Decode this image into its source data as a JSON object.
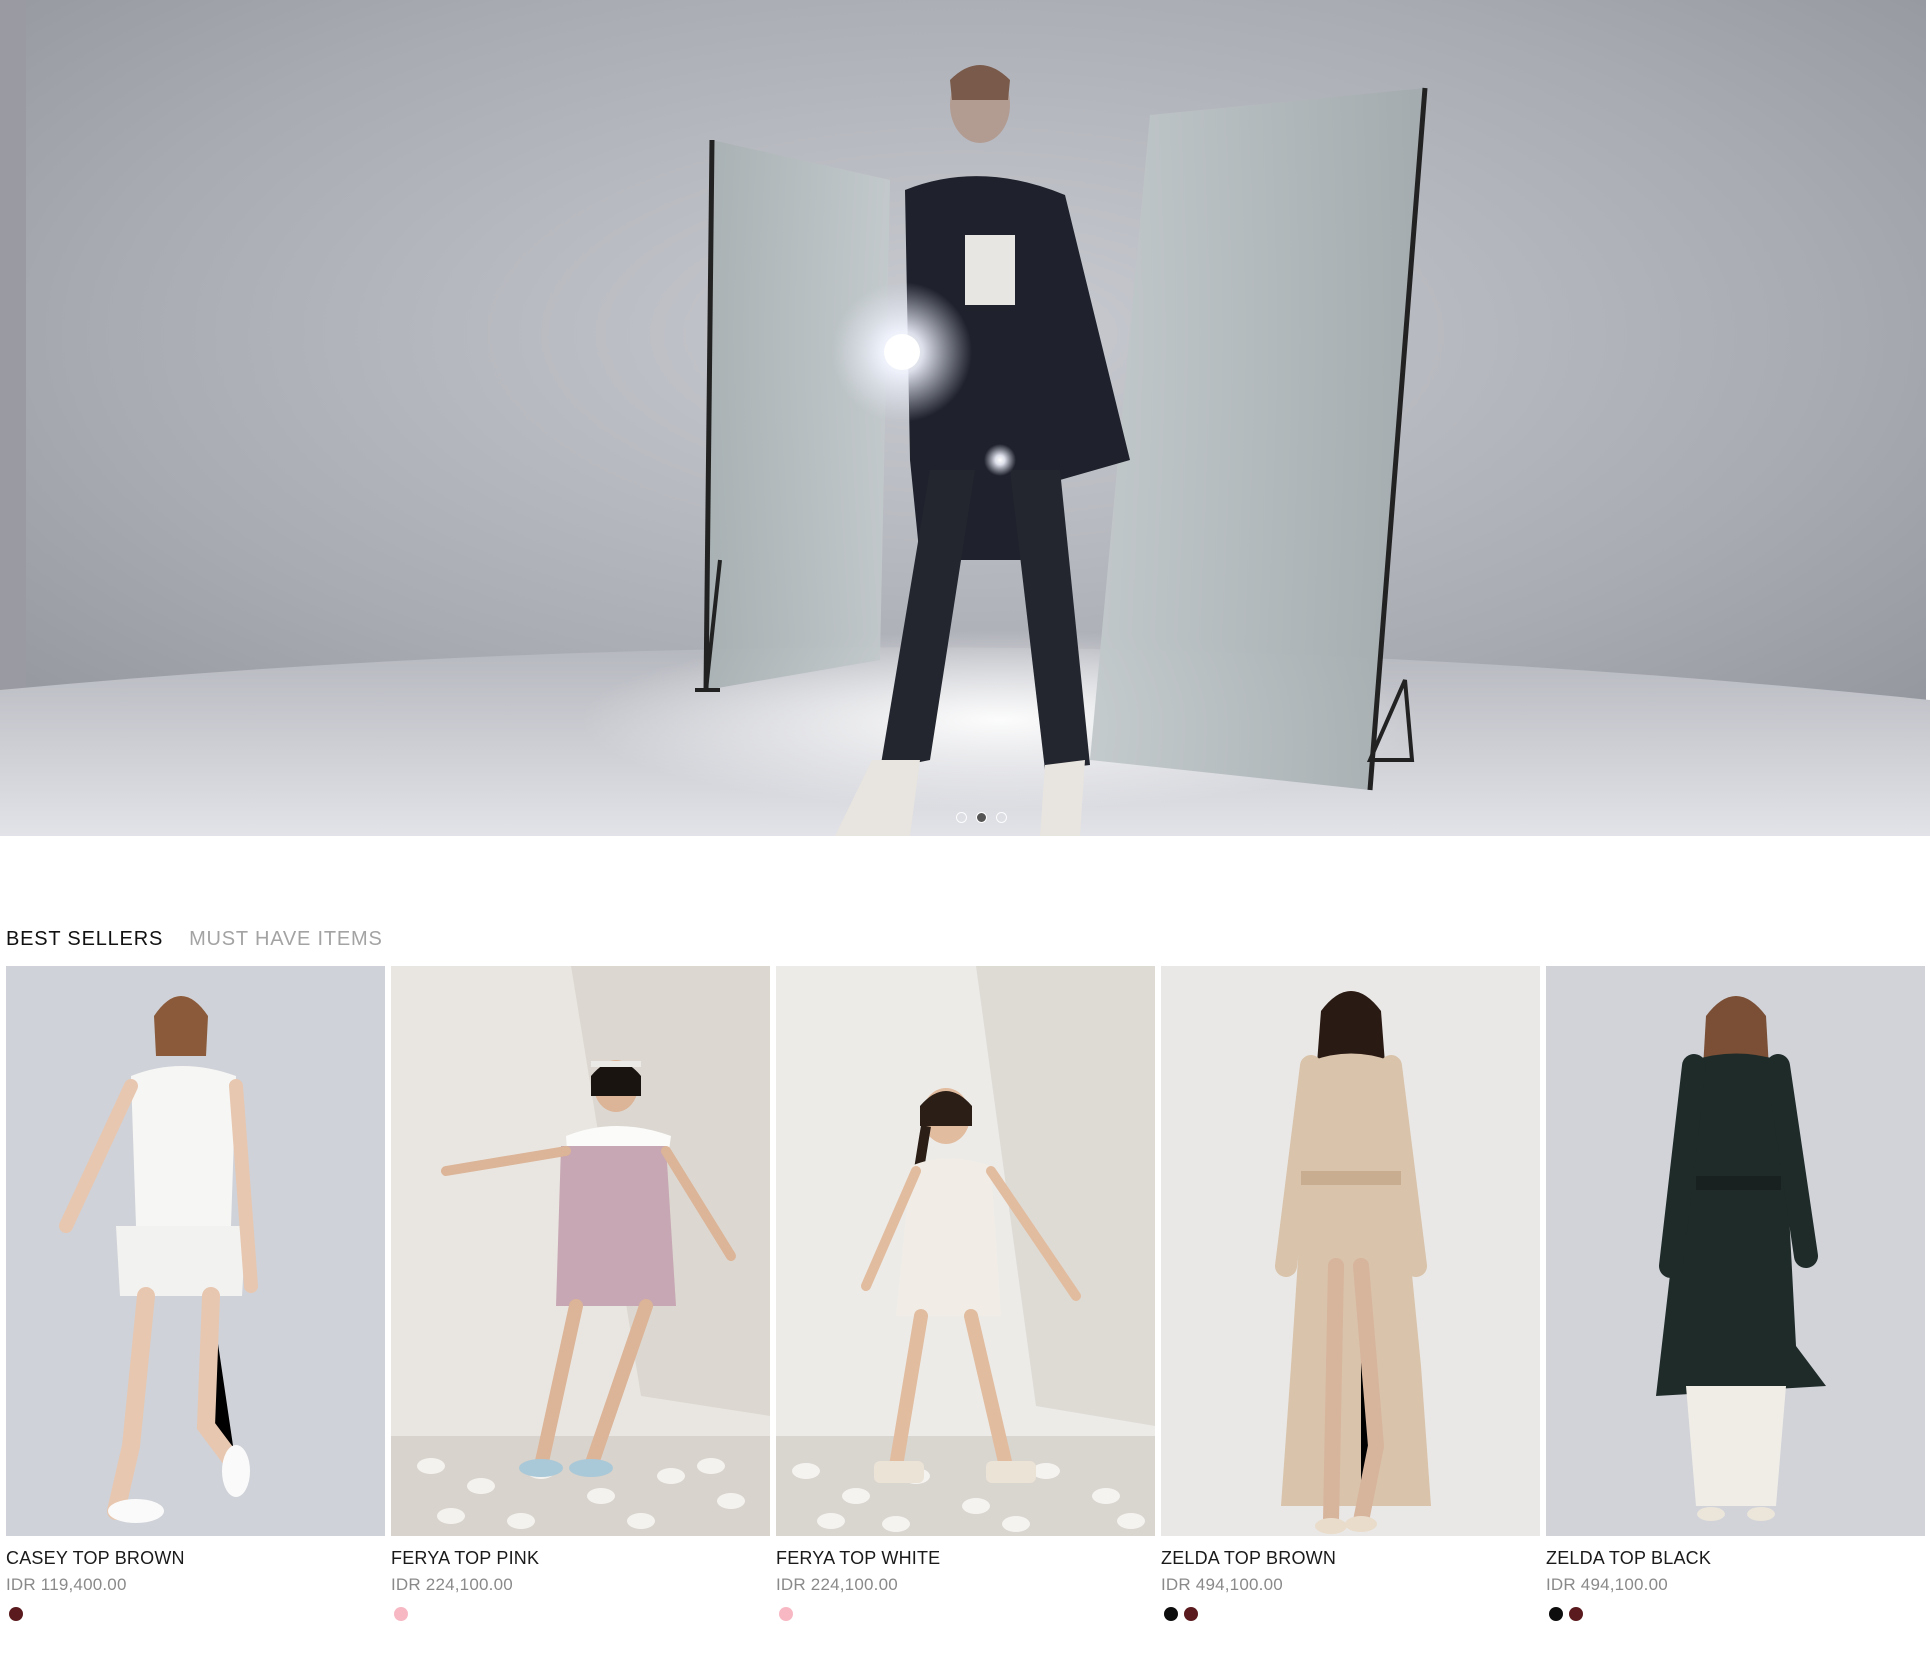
{
  "hero": {
    "slides": 3,
    "active_slide": 2
  },
  "tabs": [
    {
      "label": "BEST SELLERS",
      "active": true
    },
    {
      "label": "MUST HAVE ITEMS",
      "active": false
    }
  ],
  "products": [
    {
      "name": "CASEY TOP BROWN",
      "price": "IDR 119,400.00",
      "swatches": [
        "#5a1a1e"
      ]
    },
    {
      "name": "FERYA TOP PINK",
      "price": "IDR 224,100.00",
      "swatches": [
        "#f7b8c4"
      ]
    },
    {
      "name": "FERYA TOP WHITE",
      "price": "IDR 224,100.00",
      "swatches": [
        "#f7b8c4"
      ]
    },
    {
      "name": "ZELDA TOP BROWN",
      "price": "IDR 494,100.00",
      "swatches": [
        "#0d0d0d",
        "#5a1a1e"
      ]
    },
    {
      "name": "ZELDA TOP BLACK",
      "price": "IDR 494,100.00",
      "swatches": [
        "#0d0d0d",
        "#5a1a1e"
      ]
    }
  ]
}
